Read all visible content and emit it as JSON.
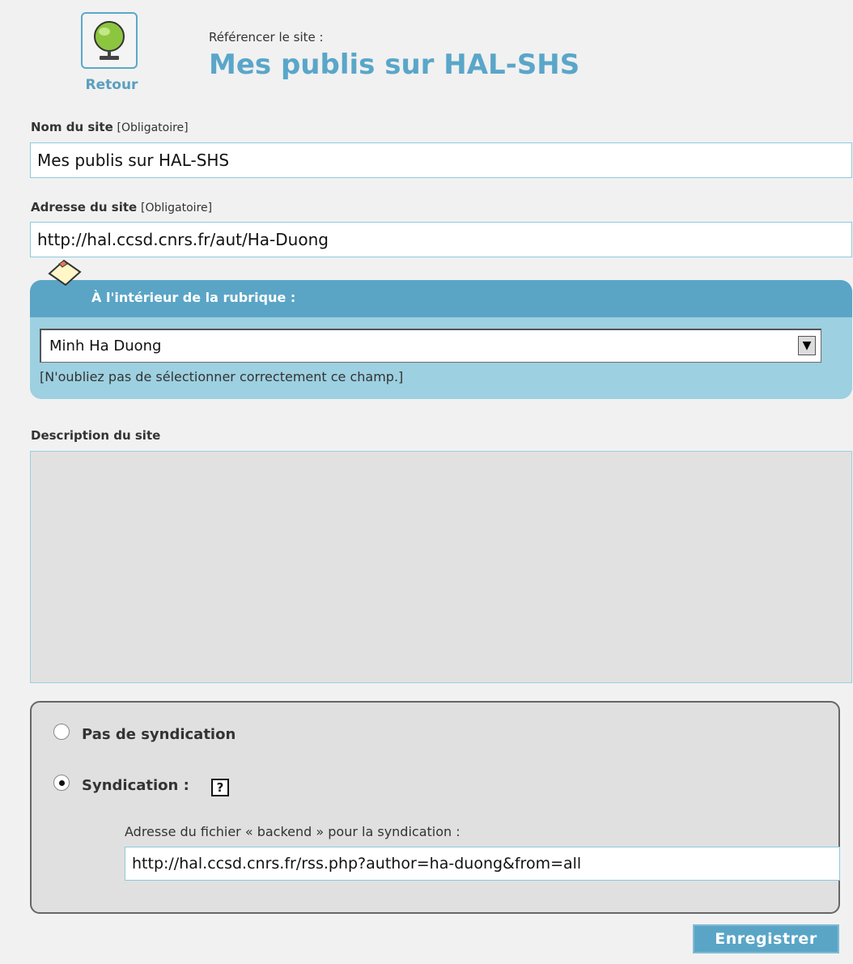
{
  "header": {
    "back_label": "Retour",
    "subtitle": "Référencer le site :",
    "title": "Mes publis sur HAL-SHS"
  },
  "fields": {
    "name_label": "Nom du site",
    "name_required": "[Obligatoire]",
    "name_value": "Mes publis sur HAL-SHS",
    "url_label": "Adresse du site",
    "url_required": "[Obligatoire]",
    "url_value": "http://hal.ccsd.cnrs.fr/aut/Ha-Duong"
  },
  "rubrique": {
    "title": "À l'intérieur de la rubrique :",
    "selected": "Minh Ha Duong",
    "hint": "[N'oubliez pas de sélectionner correctement ce champ.]"
  },
  "description": {
    "label": "Description du site",
    "value": ""
  },
  "syndication": {
    "option_none": "Pas de syndication",
    "option_yes": "Syndication :",
    "selected": "option_yes",
    "help_glyph": "?",
    "backend_label": "Adresse du fichier « backend » pour la syndication :",
    "backend_value": "http://hal.ccsd.cnrs.fr/rss.php?author=ha-duong&from=all"
  },
  "actions": {
    "save_label": "Enregistrer"
  },
  "colors": {
    "accent": "#5aa5c6",
    "accent_light": "#9dd0e0",
    "background": "#f1f1f1"
  }
}
